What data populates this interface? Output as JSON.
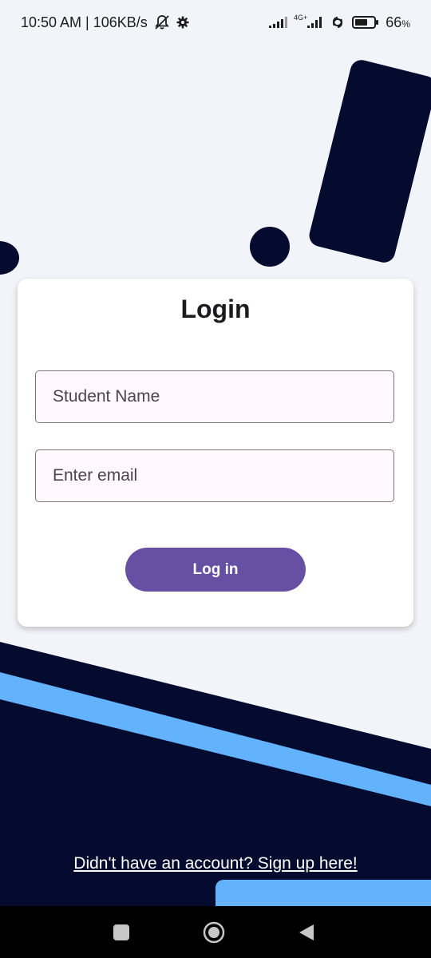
{
  "status_bar": {
    "time_speed": "10:50 AM | 106KB/s",
    "network_label": "4G+",
    "battery_percent": "66",
    "battery_suffix": "%",
    "icons": [
      "mute-icon",
      "settings-gear-icon",
      "signal-icon",
      "network-signal-icon",
      "hotspot-icon",
      "battery-icon"
    ]
  },
  "login": {
    "title": "Login",
    "name_placeholder": "Student Name",
    "email_placeholder": "Enter email",
    "name_value": "",
    "email_value": "",
    "button_label": "Log in"
  },
  "signup": {
    "link_text": "Didn't have an account? Sign up here!"
  },
  "nav": {
    "icons": [
      "recents-icon",
      "home-icon",
      "back-icon"
    ]
  },
  "colors": {
    "background": "#f3f4f9",
    "navy": "#040b2f",
    "accent_blue": "#62b3fb",
    "button_purple": "#6750a4",
    "card": "#ffffff"
  },
  "battery_level": 0.66
}
